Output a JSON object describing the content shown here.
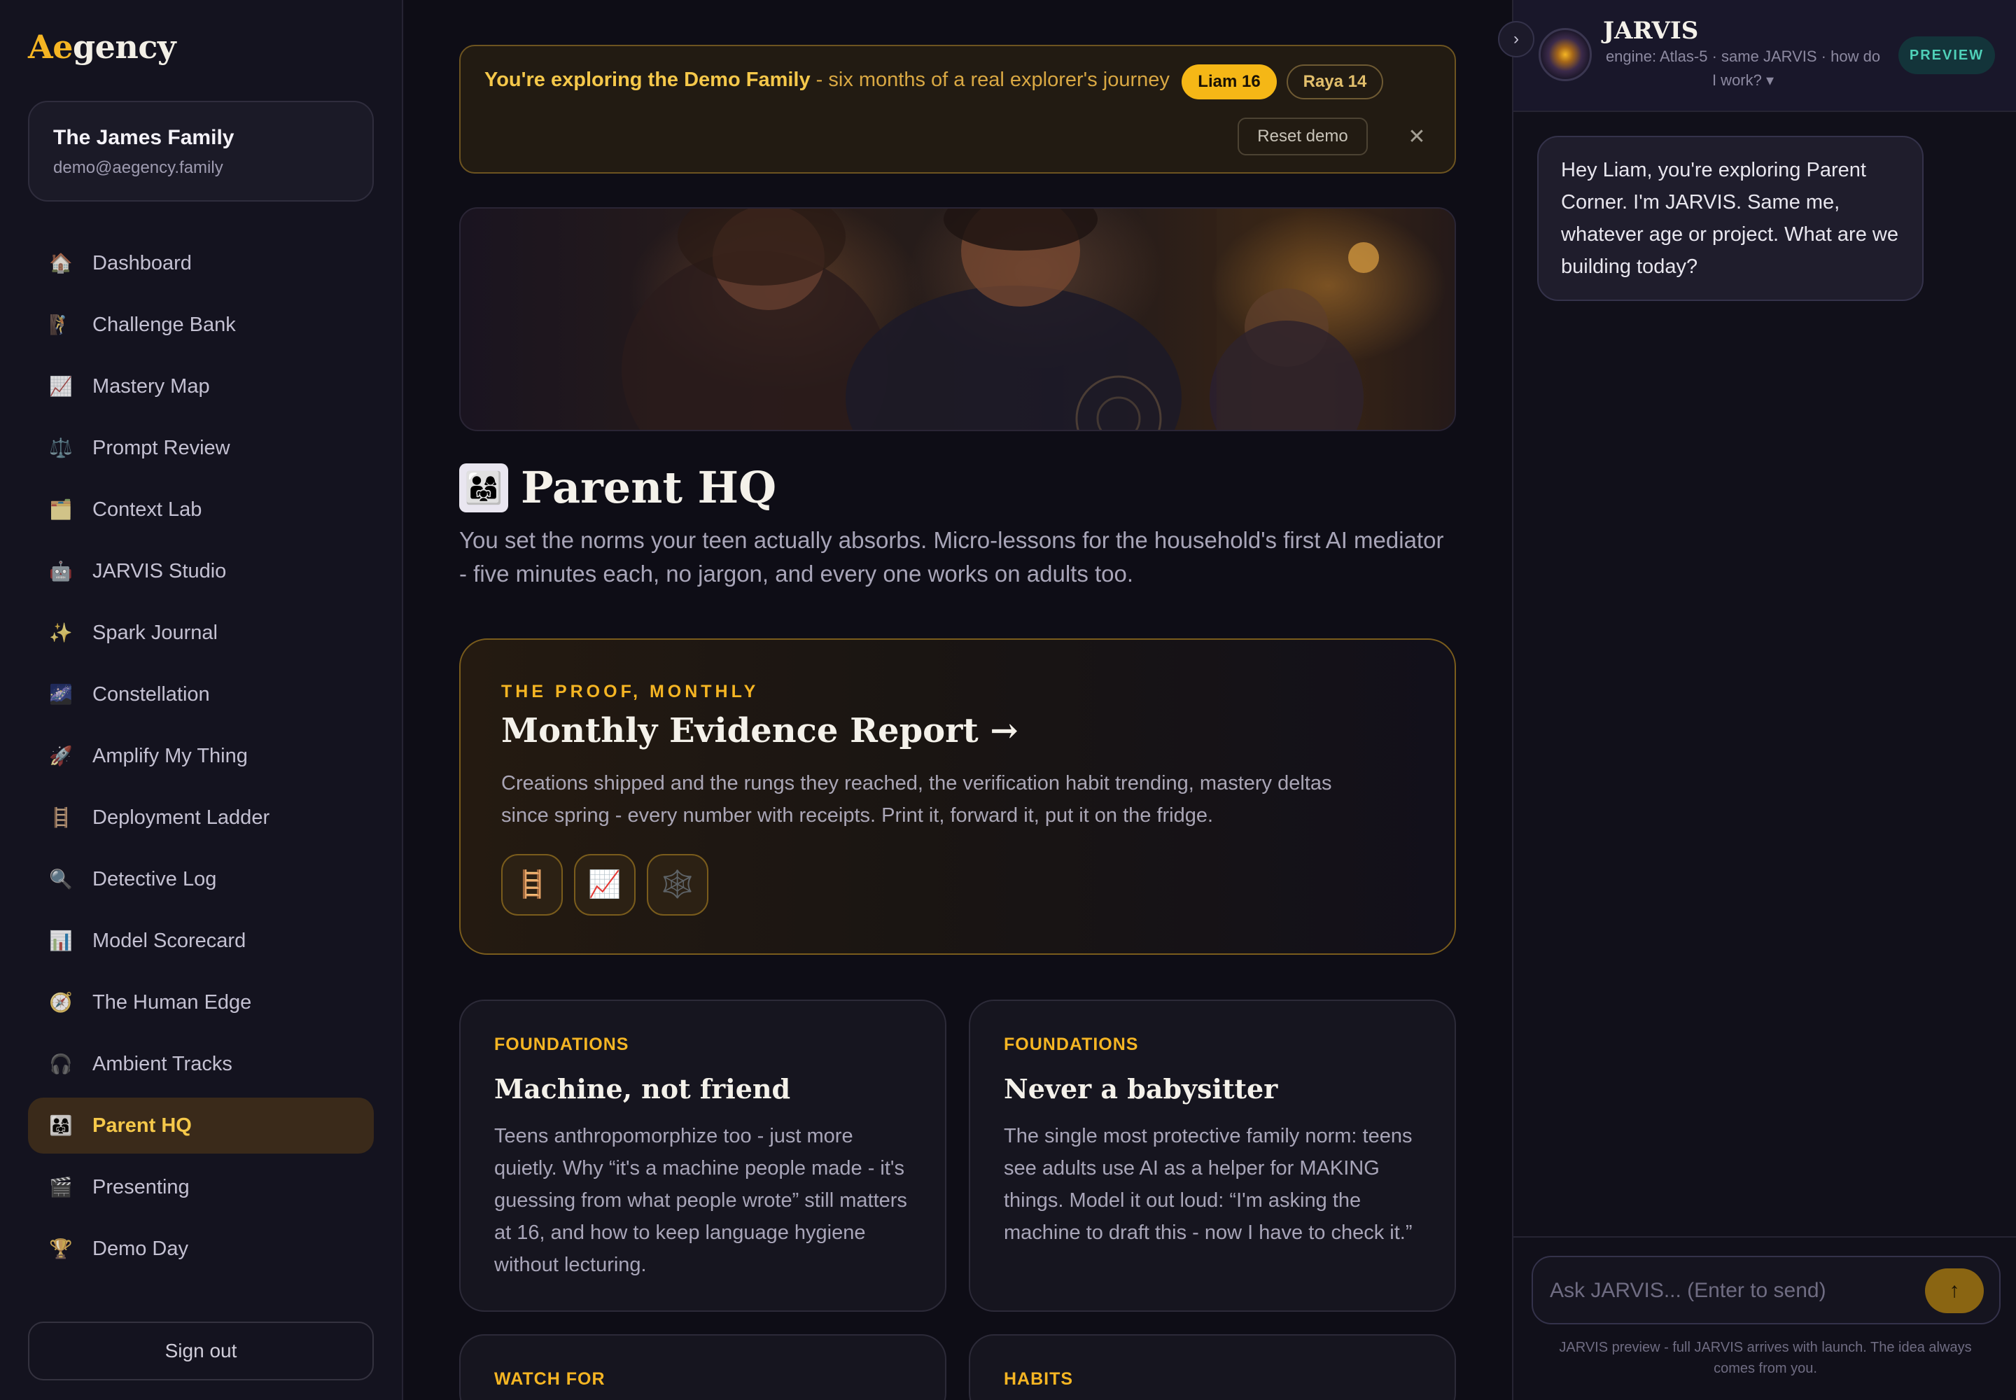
{
  "app": {
    "logo_prefix": "Ae",
    "logo_suffix": "gency"
  },
  "family": {
    "name": "The James Family",
    "email": "demo@aegency.family"
  },
  "sidebar": {
    "items": [
      {
        "icon": "house-icon",
        "glyph": "🏠",
        "label": "Dashboard"
      },
      {
        "icon": "climber-icon",
        "glyph": "🧗",
        "label": "Challenge Bank"
      },
      {
        "icon": "chart-up-icon",
        "glyph": "📈",
        "label": "Mastery Map"
      },
      {
        "icon": "scales-icon",
        "glyph": "⚖️",
        "label": "Prompt Review"
      },
      {
        "icon": "folder-icon",
        "glyph": "🗂️",
        "label": "Context Lab"
      },
      {
        "icon": "robot-icon",
        "glyph": "🤖",
        "label": "JARVIS Studio"
      },
      {
        "icon": "sparkles-icon",
        "glyph": "✨",
        "label": "Spark Journal"
      },
      {
        "icon": "milky-way-icon",
        "glyph": "🌌",
        "label": "Constellation"
      },
      {
        "icon": "rocket-icon",
        "glyph": "🚀",
        "label": "Amplify My Thing"
      },
      {
        "icon": "ladder-icon",
        "glyph": "🪜",
        "label": "Deployment Ladder"
      },
      {
        "icon": "magnifier-icon",
        "glyph": "🔍",
        "label": "Detective Log"
      },
      {
        "icon": "bar-chart-icon",
        "glyph": "📊",
        "label": "Model Scorecard"
      },
      {
        "icon": "compass-icon",
        "glyph": "🧭",
        "label": "The Human Edge"
      },
      {
        "icon": "headphones-icon",
        "glyph": "🎧",
        "label": "Ambient Tracks"
      },
      {
        "icon": "family-icon",
        "glyph": "👨‍👩‍👧",
        "label": "Parent HQ",
        "active": true
      },
      {
        "icon": "clapper-icon",
        "glyph": "🎬",
        "label": "Presenting"
      },
      {
        "icon": "trophy-icon",
        "glyph": "🏆",
        "label": "Demo Day"
      }
    ],
    "signout_label": "Sign out"
  },
  "banner": {
    "bold": "You're exploring the Demo Family",
    "rest": " - six months of a real explorer's journey",
    "pill_liam": "Liam 16",
    "pill_raya": "Raya 14",
    "reset_label": "Reset demo",
    "close_glyph": "✕"
  },
  "page": {
    "title_glyph": "👨‍👩‍👧",
    "title": "Parent HQ",
    "subtitle": "You set the norms your teen actually absorbs. Micro-lessons for the household's first AI mediator - five minutes each, no jargon, and every one works on adults too."
  },
  "report": {
    "eyebrow": "THE PROOF, MONTHLY",
    "title": "Monthly Evidence Report →",
    "desc": "Creations shipped and the rungs they reached, the verification habit trending, mastery deltas since spring - every number with receipts. Print it, forward it, put it on the fridge.",
    "chips": [
      "🪜",
      "📈",
      "🕸️"
    ]
  },
  "tiles": [
    {
      "eyebrow": "FOUNDATIONS",
      "title": "Machine, not friend",
      "desc": "Teens anthropomorphize too - just more quietly. Why “it's a machine people made - it's guessing from what people wrote” still matters at 16, and how to keep language hygiene without lecturing."
    },
    {
      "eyebrow": "FOUNDATIONS",
      "title": "Never a babysitter",
      "desc": "The single most protective family norm: teens see adults use AI as a helper for MAKING things. Model it out loud: “I'm asking the machine to draft this - now I have to check it.”"
    },
    {
      "eyebrow": "WATCH FOR",
      "title": "",
      "desc": ""
    },
    {
      "eyebrow": "HABITS",
      "title": "",
      "desc": ""
    }
  ],
  "jarvis": {
    "collapse_glyph": "›",
    "name": "JARVIS",
    "engine": "engine: Atlas-5 · same JARVIS · how do I work? ▾",
    "badge": "PREVIEW",
    "message": "Hey Liam, you're exploring Parent Corner. I'm JARVIS. Same me, whatever age or project. What are we building today?",
    "input_placeholder": "Ask JARVIS... (Enter to send)",
    "send_glyph": "↑",
    "footer": "JARVIS preview - full JARVIS arrives with launch. The idea always comes from you."
  },
  "colors": {
    "accent": "#f5b523",
    "active_bg": "#3a2a1a",
    "preview_badge": "#4fd0b8"
  }
}
